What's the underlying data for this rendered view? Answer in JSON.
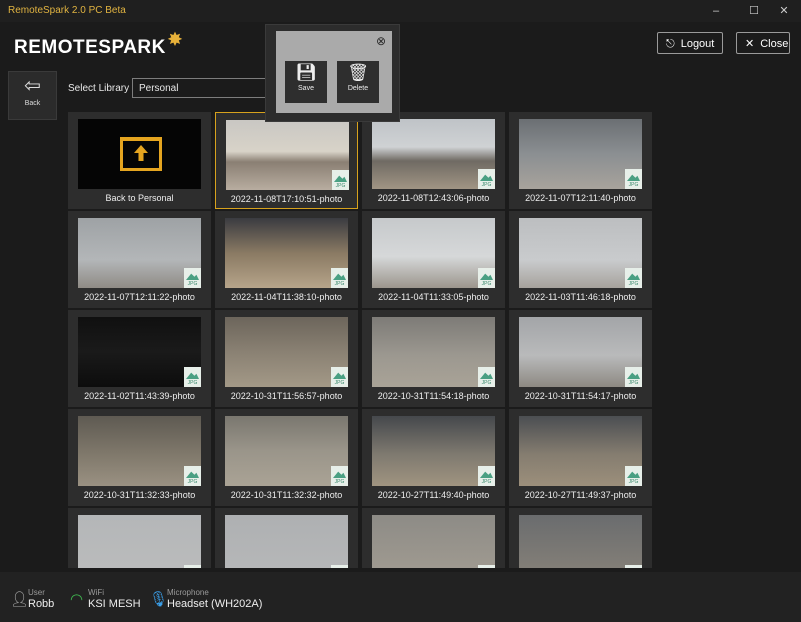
{
  "window": {
    "title": "RemoteSpark 2.0 PC Beta",
    "minimize": "–",
    "maximize": "☐",
    "close": "✕"
  },
  "header": {
    "logo_main": "REMOTESPARK",
    "logout_label": "Logout",
    "close_label": "Close"
  },
  "back": {
    "label": "Back"
  },
  "library": {
    "label": "Select Library",
    "value": "Personal"
  },
  "popup": {
    "save_label": "Save",
    "delete_label": "Delete"
  },
  "tiles": [
    {
      "caption": "Back to Personal"
    },
    {
      "caption": "2022-11-08T17:10:51-photo"
    },
    {
      "caption": "2022-11-08T12:43:06-photo"
    },
    {
      "caption": "2022-11-07T12:11:40-photo"
    },
    {
      "caption": "2022-11-07T12:11:22-photo"
    },
    {
      "caption": "2022-11-04T11:38:10-photo"
    },
    {
      "caption": "2022-11-04T11:33:05-photo"
    },
    {
      "caption": "2022-11-03T11:46:18-photo"
    },
    {
      "caption": "2022-11-02T11:43:39-photo"
    },
    {
      "caption": "2022-10-31T11:56:57-photo"
    },
    {
      "caption": "2022-10-31T11:54:18-photo"
    },
    {
      "caption": "2022-10-31T11:54:17-photo"
    },
    {
      "caption": "2022-10-31T11:32:33-photo"
    },
    {
      "caption": "2022-10-31T11:32:32-photo"
    },
    {
      "caption": "2022-10-27T11:49:40-photo"
    },
    {
      "caption": "2022-10-27T11:49:37-photo"
    },
    {
      "caption": ""
    },
    {
      "caption": ""
    },
    {
      "caption": ""
    },
    {
      "caption": ""
    }
  ],
  "jpg_badge": "JPG",
  "status": {
    "user_key": "User",
    "user_value": "Robb",
    "wifi_key": "WiFi",
    "wifi_value": "KSI MESH",
    "mic_key": "Microphone",
    "mic_value": "Headset (WH202A)"
  }
}
